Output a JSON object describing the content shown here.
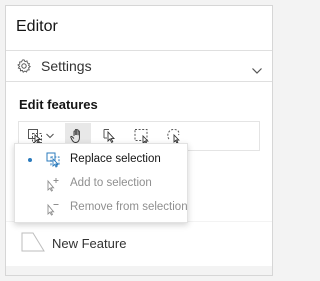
{
  "header": {
    "title": "Editor"
  },
  "settings": {
    "label": "Settings",
    "icon": "gear-icon"
  },
  "section": {
    "title": "Edit features"
  },
  "toolbar": {
    "tools": [
      {
        "icon": "replace-selection-icon",
        "active": false,
        "dropdown": true
      },
      {
        "icon": "pan-hand-icon",
        "active": true
      },
      {
        "icon": "select-by-click-icon",
        "active": false
      },
      {
        "icon": "rectangle-select-icon",
        "active": false
      },
      {
        "icon": "lasso-select-icon",
        "active": false
      }
    ]
  },
  "selection_menu": {
    "items": [
      {
        "label": "Replace selection",
        "icon": "replace-selection-icon",
        "selected": true,
        "enabled": true
      },
      {
        "label": "Add to selection",
        "icon": "add-to-selection-icon",
        "selected": false,
        "enabled": false
      },
      {
        "label": "Remove from selection",
        "icon": "remove-from-selection-icon",
        "selected": false,
        "enabled": false
      }
    ]
  },
  "features": [
    {
      "name": "New Feature",
      "icon": "polygon-feature-icon"
    }
  ],
  "colors": {
    "accent": "#2b7bbd",
    "background": "#f3f3f3",
    "border": "#dfdfdf"
  }
}
